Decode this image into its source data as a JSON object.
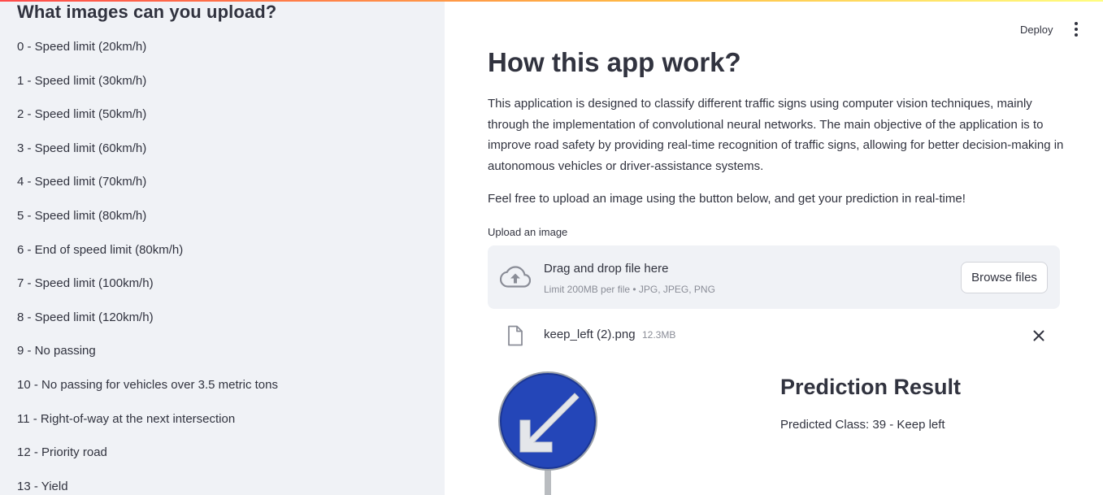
{
  "sidebar": {
    "heading": "What images can you upload?",
    "items": [
      "0 - Speed limit (20km/h)",
      "1 - Speed limit (30km/h)",
      "2 - Speed limit (50km/h)",
      "3 - Speed limit (60km/h)",
      "4 - Speed limit (70km/h)",
      "5 - Speed limit (80km/h)",
      "6 - End of speed limit (80km/h)",
      "7 - Speed limit (100km/h)",
      "8 - Speed limit (120km/h)",
      "9 - No passing",
      "10 - No passing for vehicles over 3.5 metric tons",
      "11 - Right-of-way at the next intersection",
      "12 - Priority road",
      "13 - Yield"
    ]
  },
  "header": {
    "deploy_label": "Deploy",
    "menu_icon": "kebab-menu-icon"
  },
  "main": {
    "title": "How this app work?",
    "description": "This application is designed to classify different traffic signs using computer vision techniques, mainly through the implementation of convolutional neural networks. The main objective of the application is to improve road safety by providing real-time recognition of traffic signs, allowing for better decision-making in autonomous vehicles or driver-assistance systems.",
    "instruction": "Feel free to upload an image using the button below, and get your prediction in real-time!",
    "upload": {
      "label": "Upload an image",
      "drop_text": "Drag and drop file here",
      "limit_text": "Limit 200MB per file • JPG, JPEG, PNG",
      "browse_label": "Browse files",
      "icon": "cloud-upload-icon"
    },
    "file": {
      "name": "keep_left (2).png",
      "size": "12.3MB",
      "icon": "file-icon",
      "remove_icon": "close-icon"
    },
    "result": {
      "title": "Prediction Result",
      "text": "Predicted Class: 39 - Keep left"
    }
  },
  "colors": {
    "sidebar_bg": "#f0f2f6",
    "text": "#31333f",
    "muted": "#8a8d97",
    "sign_blue": "#2446b8"
  }
}
